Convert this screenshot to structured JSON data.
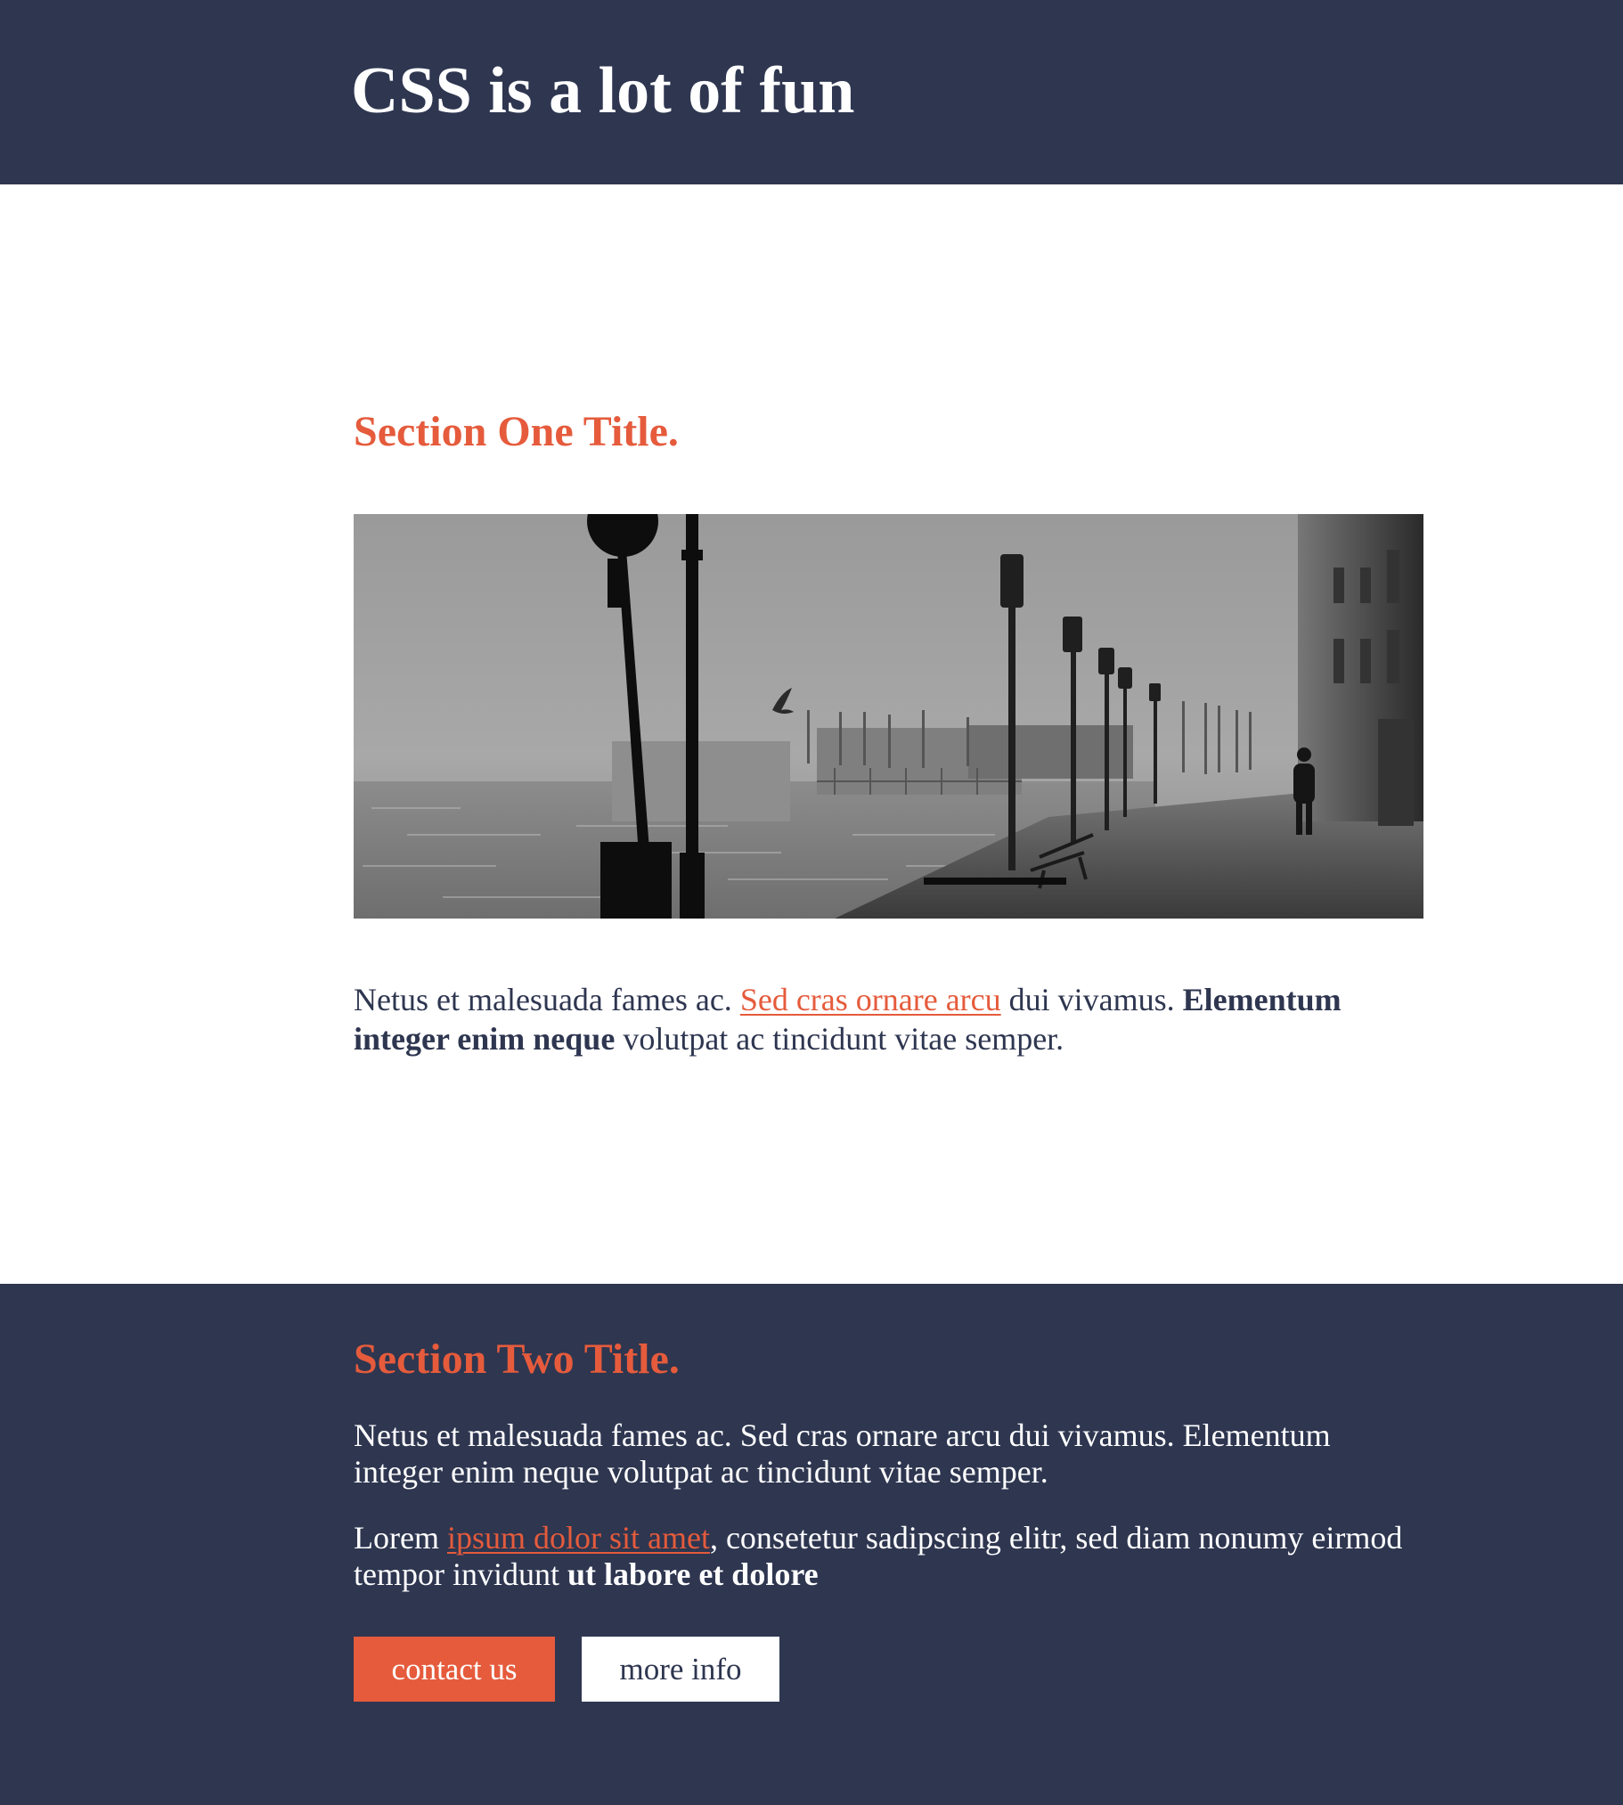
{
  "header": {
    "title": "CSS is a lot of fun"
  },
  "section_one": {
    "title": "Section One Title.",
    "image_alt": "Foggy waterfront promenade with street lamps",
    "text_before_link": "Netus et malesuada fames ac. ",
    "link_text": "Sed cras ornare arcu",
    "text_after_link": " dui vivamus. ",
    "bold_text": "Elementum integer enim neque",
    "text_end": " volutpat ac tincidunt vitae semper."
  },
  "section_two": {
    "title": "Section Two Title.",
    "paragraph_1": "Netus et malesuada fames ac. Sed cras ornare arcu dui vivamus. Elementum integer enim neque volutpat ac tincidunt vitae semper.",
    "p2_before_link": "Lorem ",
    "p2_link_text": "ipsum dolor sit amet",
    "p2_after_link": ", consetetur sadipscing elitr, sed diam nonumy eirmod tempor invidunt ",
    "p2_bold": "ut labore et dolore",
    "buttons": {
      "contact_label": "contact us",
      "more_label": "more info"
    }
  },
  "colors": {
    "navy": "#2e3650",
    "accent": "#e55b3c",
    "white": "#ffffff"
  }
}
